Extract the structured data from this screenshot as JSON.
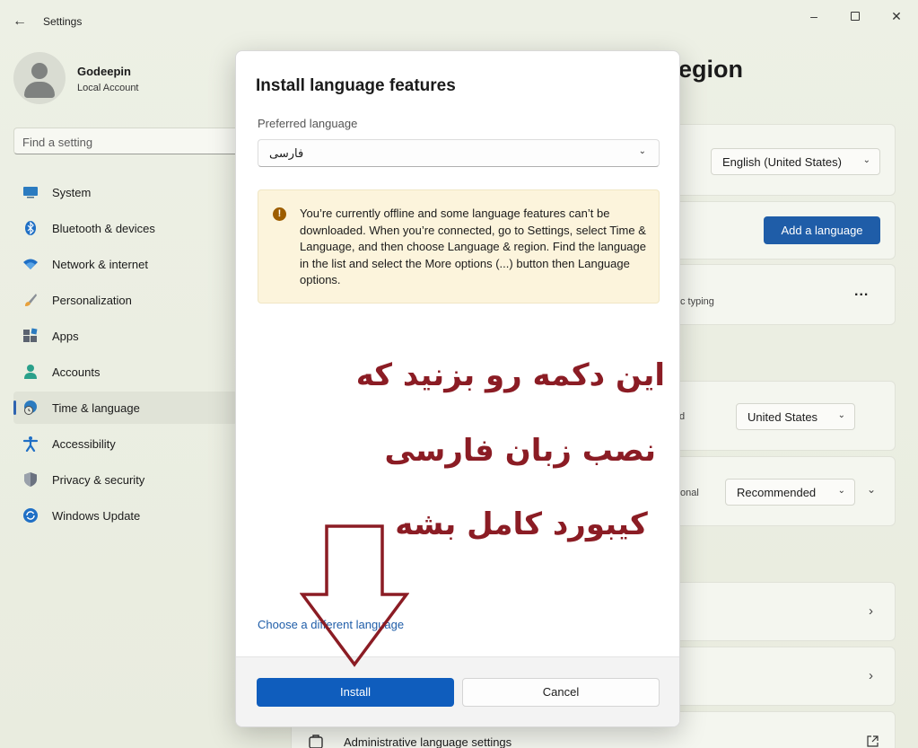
{
  "titlebar": {
    "title": "Settings",
    "back_icon": "arrow-left-icon",
    "minimize_icon": "minimize-icon",
    "maximize_icon": "maximize-icon",
    "close_icon": "close-icon"
  },
  "profile": {
    "name": "Godeepin",
    "account_type": "Local Account"
  },
  "search": {
    "placeholder": "Find a setting"
  },
  "sidebar": {
    "items": [
      {
        "label": "System",
        "icon": "monitor-icon",
        "active": false
      },
      {
        "label": "Bluetooth & devices",
        "icon": "bluetooth-icon",
        "active": false
      },
      {
        "label": "Network & internet",
        "icon": "wifi-icon",
        "active": false
      },
      {
        "label": "Personalization",
        "icon": "brush-icon",
        "active": false
      },
      {
        "label": "Apps",
        "icon": "apps-icon",
        "active": false
      },
      {
        "label": "Accounts",
        "icon": "person-icon",
        "active": false
      },
      {
        "label": "Time & language",
        "icon": "globe-clock-icon",
        "active": true
      },
      {
        "label": "Accessibility",
        "icon": "accessibility-icon",
        "active": false
      },
      {
        "label": "Privacy & security",
        "icon": "shield-icon",
        "active": false
      },
      {
        "label": "Windows Update",
        "icon": "update-icon",
        "active": false
      }
    ]
  },
  "background_page": {
    "heading_fragment": "egion",
    "display_language_value": "English (United States)",
    "add_language_button": "Add a language",
    "typing_fragment": "c typing",
    "more_options": "...",
    "region_fragment": "d",
    "country_value": "United States",
    "format_fragment": "onal",
    "format_value": "Recommended",
    "admin_settings_label": "Administrative language settings"
  },
  "dialog": {
    "title": "Install language features",
    "preferred_label": "Preferred language",
    "preferred_value": "فارسی",
    "warning_text": "You’re currently offline and some language features can’t be downloaded. When you’re connected, go to Settings, select Time & Language, and then choose Language & region. Find the language in the list and select the More options (...) button then Language options.",
    "warning_icon": "!",
    "choose_link": "Choose a different language",
    "install_button": "Install",
    "cancel_button": "Cancel"
  },
  "annotation": {
    "line1": "این دکمه رو بزنید که",
    "line2": "نصب زبان فارسی",
    "line3": "کیبورد کامل بشه",
    "color": "#8b1c24"
  },
  "colors": {
    "accent": "#0f5dbd",
    "warning_bg": "#fcf4dc",
    "warning_icon": "#9d5d00"
  }
}
